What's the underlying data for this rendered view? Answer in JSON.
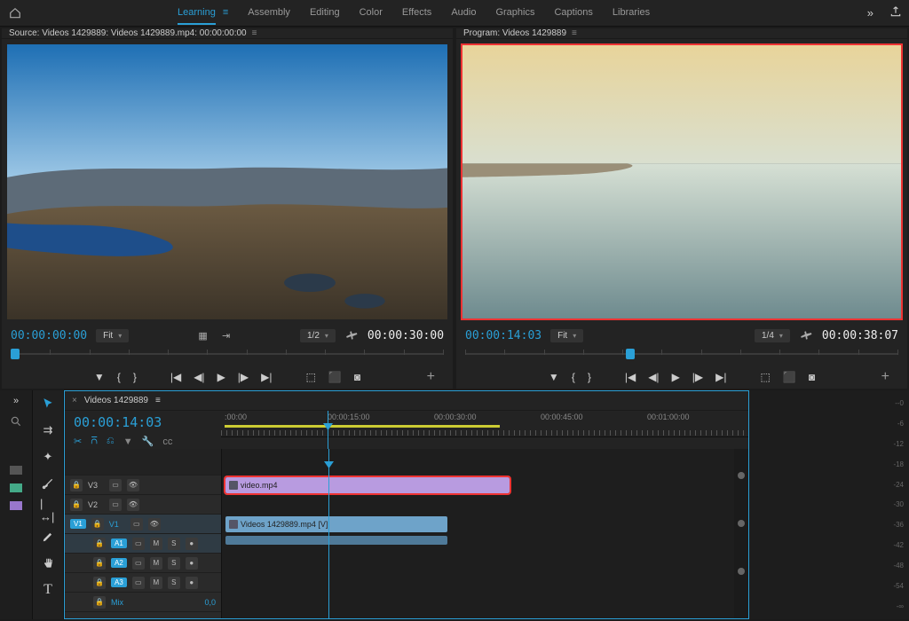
{
  "topbar": {
    "tabs": [
      "Learning",
      "Assembly",
      "Editing",
      "Color",
      "Effects",
      "Audio",
      "Graphics",
      "Captions",
      "Libraries"
    ],
    "active": "Learning"
  },
  "source": {
    "title": "Source: Videos 1429889: Videos 1429889.mp4: 00:00:00:00",
    "tc": "00:00:00:00",
    "fit": "Fit",
    "zoom": "1/2",
    "dur": "00:00:30:00"
  },
  "program": {
    "title": "Program: Videos 1429889",
    "tc": "00:00:14:03",
    "fit": "Fit",
    "zoom": "1/4",
    "dur": "00:00:38:07"
  },
  "timeline": {
    "tab": "Videos 1429889",
    "tc": "00:00:14:03",
    "ruler": [
      ":00:00",
      "00:00:15:00",
      "00:00:30:00",
      "00:00:45:00",
      "00:01:00:00"
    ],
    "tracks": {
      "v3": "V3",
      "v2": "V2",
      "v1": "V1",
      "a1": "A1",
      "a2": "A2",
      "a3": "A3",
      "mix": "Mix",
      "mixval": "0,0",
      "v1tag": "V1"
    },
    "btn": {
      "lock": "🔒",
      "eye": "👁",
      "film": "▭",
      "m": "M",
      "s": "S",
      "mic": "●"
    },
    "clips": {
      "v3": "video.mp4",
      "v1": "Videos 1429889.mp4 [V]"
    }
  },
  "meter": {
    "labels": [
      "--0",
      "-6",
      "-12",
      "-18",
      "-24",
      "-30",
      "-36",
      "-42",
      "-48",
      "-54",
      "-∞"
    ]
  },
  "icons": {
    "brace_l": "{",
    "brace_r": "}",
    "mark_in": "◀",
    "mark_out": "▶",
    "step_b": "◀|",
    "play": "▶",
    "step_f": "|▶",
    "plus": "+",
    "arrow_dd": "▾"
  }
}
